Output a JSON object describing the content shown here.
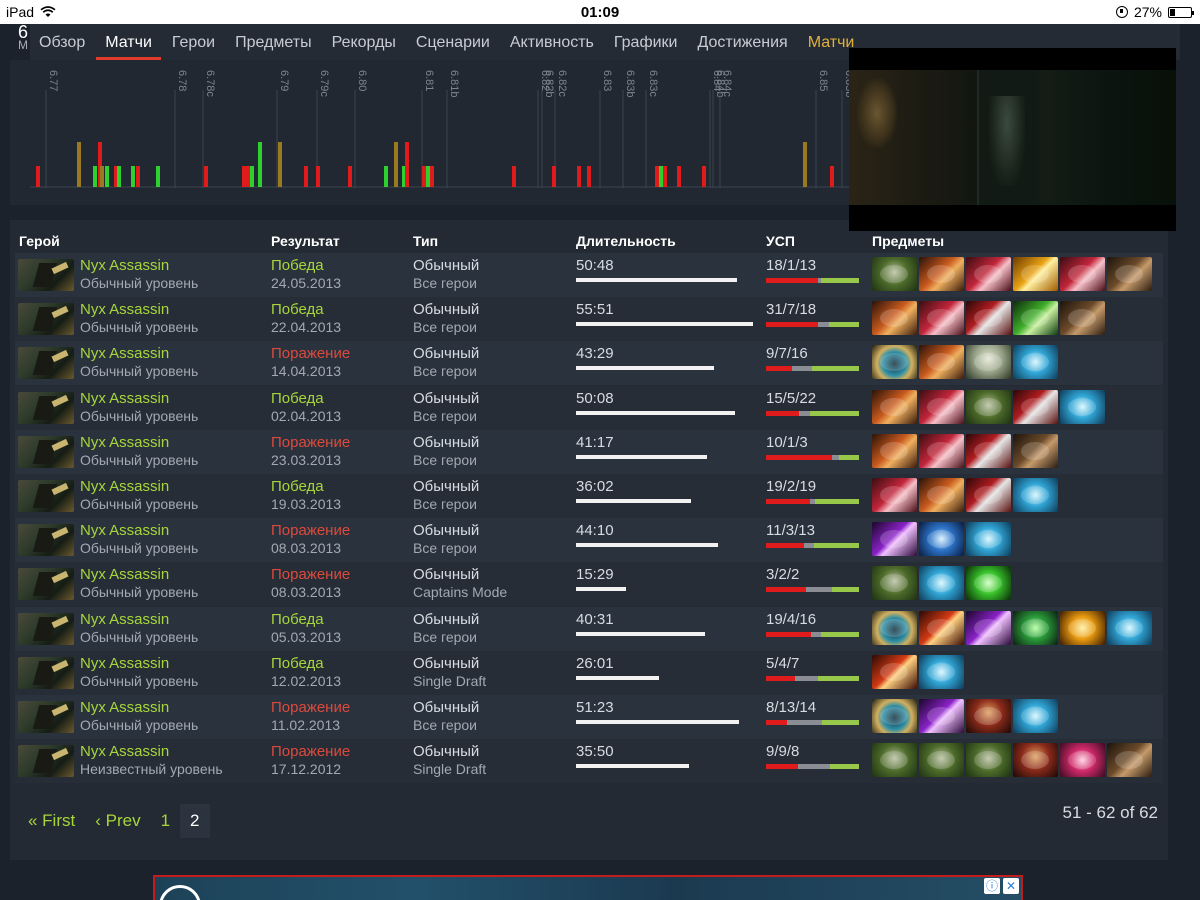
{
  "status_bar": {
    "device": "iPad",
    "time": "01:09",
    "battery": "27%",
    "battery_level": 0.27
  },
  "profile_fragment": {
    "title": "6",
    "subtitle": "М"
  },
  "tabs": [
    {
      "label": "Обзор"
    },
    {
      "label": "Матчи"
    },
    {
      "label": "Герои"
    },
    {
      "label": "Предметы"
    },
    {
      "label": "Рекорды"
    },
    {
      "label": "Сценарии"
    },
    {
      "label": "Активность"
    },
    {
      "label": "Графики"
    },
    {
      "label": "Достижения"
    },
    {
      "label": "Матчи"
    }
  ],
  "chart_data": {
    "type": "bar",
    "versions": [
      "6.77",
      "6.78",
      "6.78c",
      "6.79",
      "6.79c",
      "6.80",
      "6.81",
      "6.81b",
      "6.82",
      "6.82b",
      "6.82c",
      "6.83",
      "6.83b",
      "6.83c",
      "6.84",
      "6.84b",
      "6.84c",
      "6.85",
      "6.85b"
    ],
    "colors": {
      "win": "#2ed02e",
      "loss": "#e01b1b",
      "abandon": "#9a7a1e"
    }
  },
  "table": {
    "headers": {
      "hero": "Герой",
      "result": "Результат",
      "type": "Тип",
      "duration": "Длительность",
      "kda": "УСП",
      "items": "Предметы"
    },
    "rows": [
      {
        "hero": "Nyx Assassin",
        "skill": "Обычный уровень",
        "result": "Победа",
        "win": true,
        "date": "24.05.2013",
        "type": "Обычный",
        "mode": "Все герои",
        "duration": "50:48",
        "dur_fill": 0.91,
        "kda": "18/1/13",
        "k": 18,
        "d": 1,
        "a": 13,
        "items": [
          "skull-item",
          "axe-item",
          "claw-item",
          "gold-blade-item",
          "claw-item",
          "boot-item"
        ]
      },
      {
        "hero": "Nyx Assassin",
        "skill": "Обычный уровень",
        "result": "Победа",
        "win": true,
        "date": "22.04.2013",
        "type": "Обычный",
        "mode": "Все герои",
        "duration": "55:51",
        "dur_fill": 1.0,
        "kda": "31/7/18",
        "k": 31,
        "d": 7,
        "a": 18,
        "items": [
          "axe-item",
          "claw-item",
          "dagger-item",
          "green-blade-item",
          "boot-item"
        ]
      },
      {
        "hero": "Nyx Assassin",
        "skill": "Обычный уровень",
        "result": "Поражение",
        "win": false,
        "date": "14.04.2013",
        "type": "Обычный",
        "mode": "Все герои",
        "duration": "43:29",
        "dur_fill": 0.78,
        "kda": "9/7/16",
        "k": 9,
        "d": 7,
        "a": 16,
        "items": [
          "ring-item",
          "axe-item",
          "mushroom-item",
          "bottle-item"
        ]
      },
      {
        "hero": "Nyx Assassin",
        "skill": "Обычный уровень",
        "result": "Победа",
        "win": true,
        "date": "02.04.2013",
        "type": "Обычный",
        "mode": "Все герои",
        "duration": "50:08",
        "dur_fill": 0.9,
        "kda": "15/5/22",
        "k": 15,
        "d": 5,
        "a": 22,
        "items": [
          "axe-item",
          "claw-item",
          "skull-item",
          "dagger-item",
          "bottle-item"
        ]
      },
      {
        "hero": "Nyx Assassin",
        "skill": "Обычный уровень",
        "result": "Поражение",
        "win": false,
        "date": "23.03.2013",
        "type": "Обычный",
        "mode": "Все герои",
        "duration": "41:17",
        "dur_fill": 0.74,
        "kda": "10/1/3",
        "k": 10,
        "d": 1,
        "a": 3,
        "items": [
          "axe-item",
          "claw-item",
          "dagger-item",
          "boot-item"
        ]
      },
      {
        "hero": "Nyx Assassin",
        "skill": "Обычный уровень",
        "result": "Победа",
        "win": true,
        "date": "19.03.2013",
        "type": "Обычный",
        "mode": "Все герои",
        "duration": "36:02",
        "dur_fill": 0.65,
        "kda": "19/2/19",
        "k": 19,
        "d": 2,
        "a": 19,
        "items": [
          "claw-item",
          "axe-item",
          "dagger-item",
          "bottle-item"
        ]
      },
      {
        "hero": "Nyx Assassin",
        "skill": "Обычный уровень",
        "result": "Поражение",
        "win": false,
        "date": "08.03.2013",
        "type": "Обычный",
        "mode": "Все герои",
        "duration": "44:10",
        "dur_fill": 0.8,
        "kda": "11/3/13",
        "k": 11,
        "d": 3,
        "a": 13,
        "items": [
          "purple-blade-item",
          "blue-orb-item",
          "bottle-item"
        ]
      },
      {
        "hero": "Nyx Assassin",
        "skill": "Обычный уровень",
        "result": "Поражение",
        "win": false,
        "date": "08.03.2013",
        "type": "Обычный",
        "mode": "Captains Mode",
        "duration": "15:29",
        "dur_fill": 0.28,
        "kda": "3/2/2",
        "k": 3,
        "d": 2,
        "a": 2,
        "items": [
          "skull-item",
          "bottle-item",
          "green-orb-item"
        ]
      },
      {
        "hero": "Nyx Assassin",
        "skill": "Обычный уровень",
        "result": "Победа",
        "win": true,
        "date": "05.03.2013",
        "type": "Обычный",
        "mode": "Все герои",
        "duration": "40:31",
        "dur_fill": 0.73,
        "kda": "19/4/16",
        "k": 19,
        "d": 4,
        "a": 16,
        "items": [
          "ring-item",
          "spear-item",
          "purple-blade-item",
          "green-gem-item",
          "orange-orb-item",
          "bottle-item"
        ]
      },
      {
        "hero": "Nyx Assassin",
        "skill": "Обычный уровень",
        "result": "Победа",
        "win": true,
        "date": "12.02.2013",
        "type": "Обычный",
        "mode": "Single Draft",
        "duration": "26:01",
        "dur_fill": 0.47,
        "kda": "5/4/7",
        "k": 5,
        "d": 4,
        "a": 7,
        "items": [
          "spear-item",
          "bottle-item"
        ]
      },
      {
        "hero": "Nyx Assassin",
        "skill": "Обычный уровень",
        "result": "Поражение",
        "win": false,
        "date": "11.02.2013",
        "type": "Обычный",
        "mode": "Все герои",
        "duration": "51:23",
        "dur_fill": 0.92,
        "kda": "8/13/14",
        "k": 8,
        "d": 13,
        "a": 14,
        "items": [
          "ring-item",
          "purple-blade-item",
          "hood-item",
          "bottle-item"
        ]
      },
      {
        "hero": "Nyx Assassin",
        "skill": "Неизвестный уровень",
        "result": "Поражение",
        "win": false,
        "date": "17.12.2012",
        "type": "Обычный",
        "mode": "Single Draft",
        "duration": "35:50",
        "dur_fill": 0.64,
        "kda": "9/9/8",
        "k": 9,
        "d": 9,
        "a": 8,
        "items": [
          "skull-item",
          "skull-item",
          "skull-item",
          "hood-item",
          "pink-orb-item",
          "boot-item"
        ]
      }
    ]
  },
  "pagination": {
    "first": "« First",
    "prev": "‹ Prev",
    "pages": [
      "1",
      "2"
    ],
    "current": "2",
    "range": "51 - 62 of 62"
  },
  "ad": {
    "info_icon": "ⓘ",
    "close_icon": "✕"
  }
}
